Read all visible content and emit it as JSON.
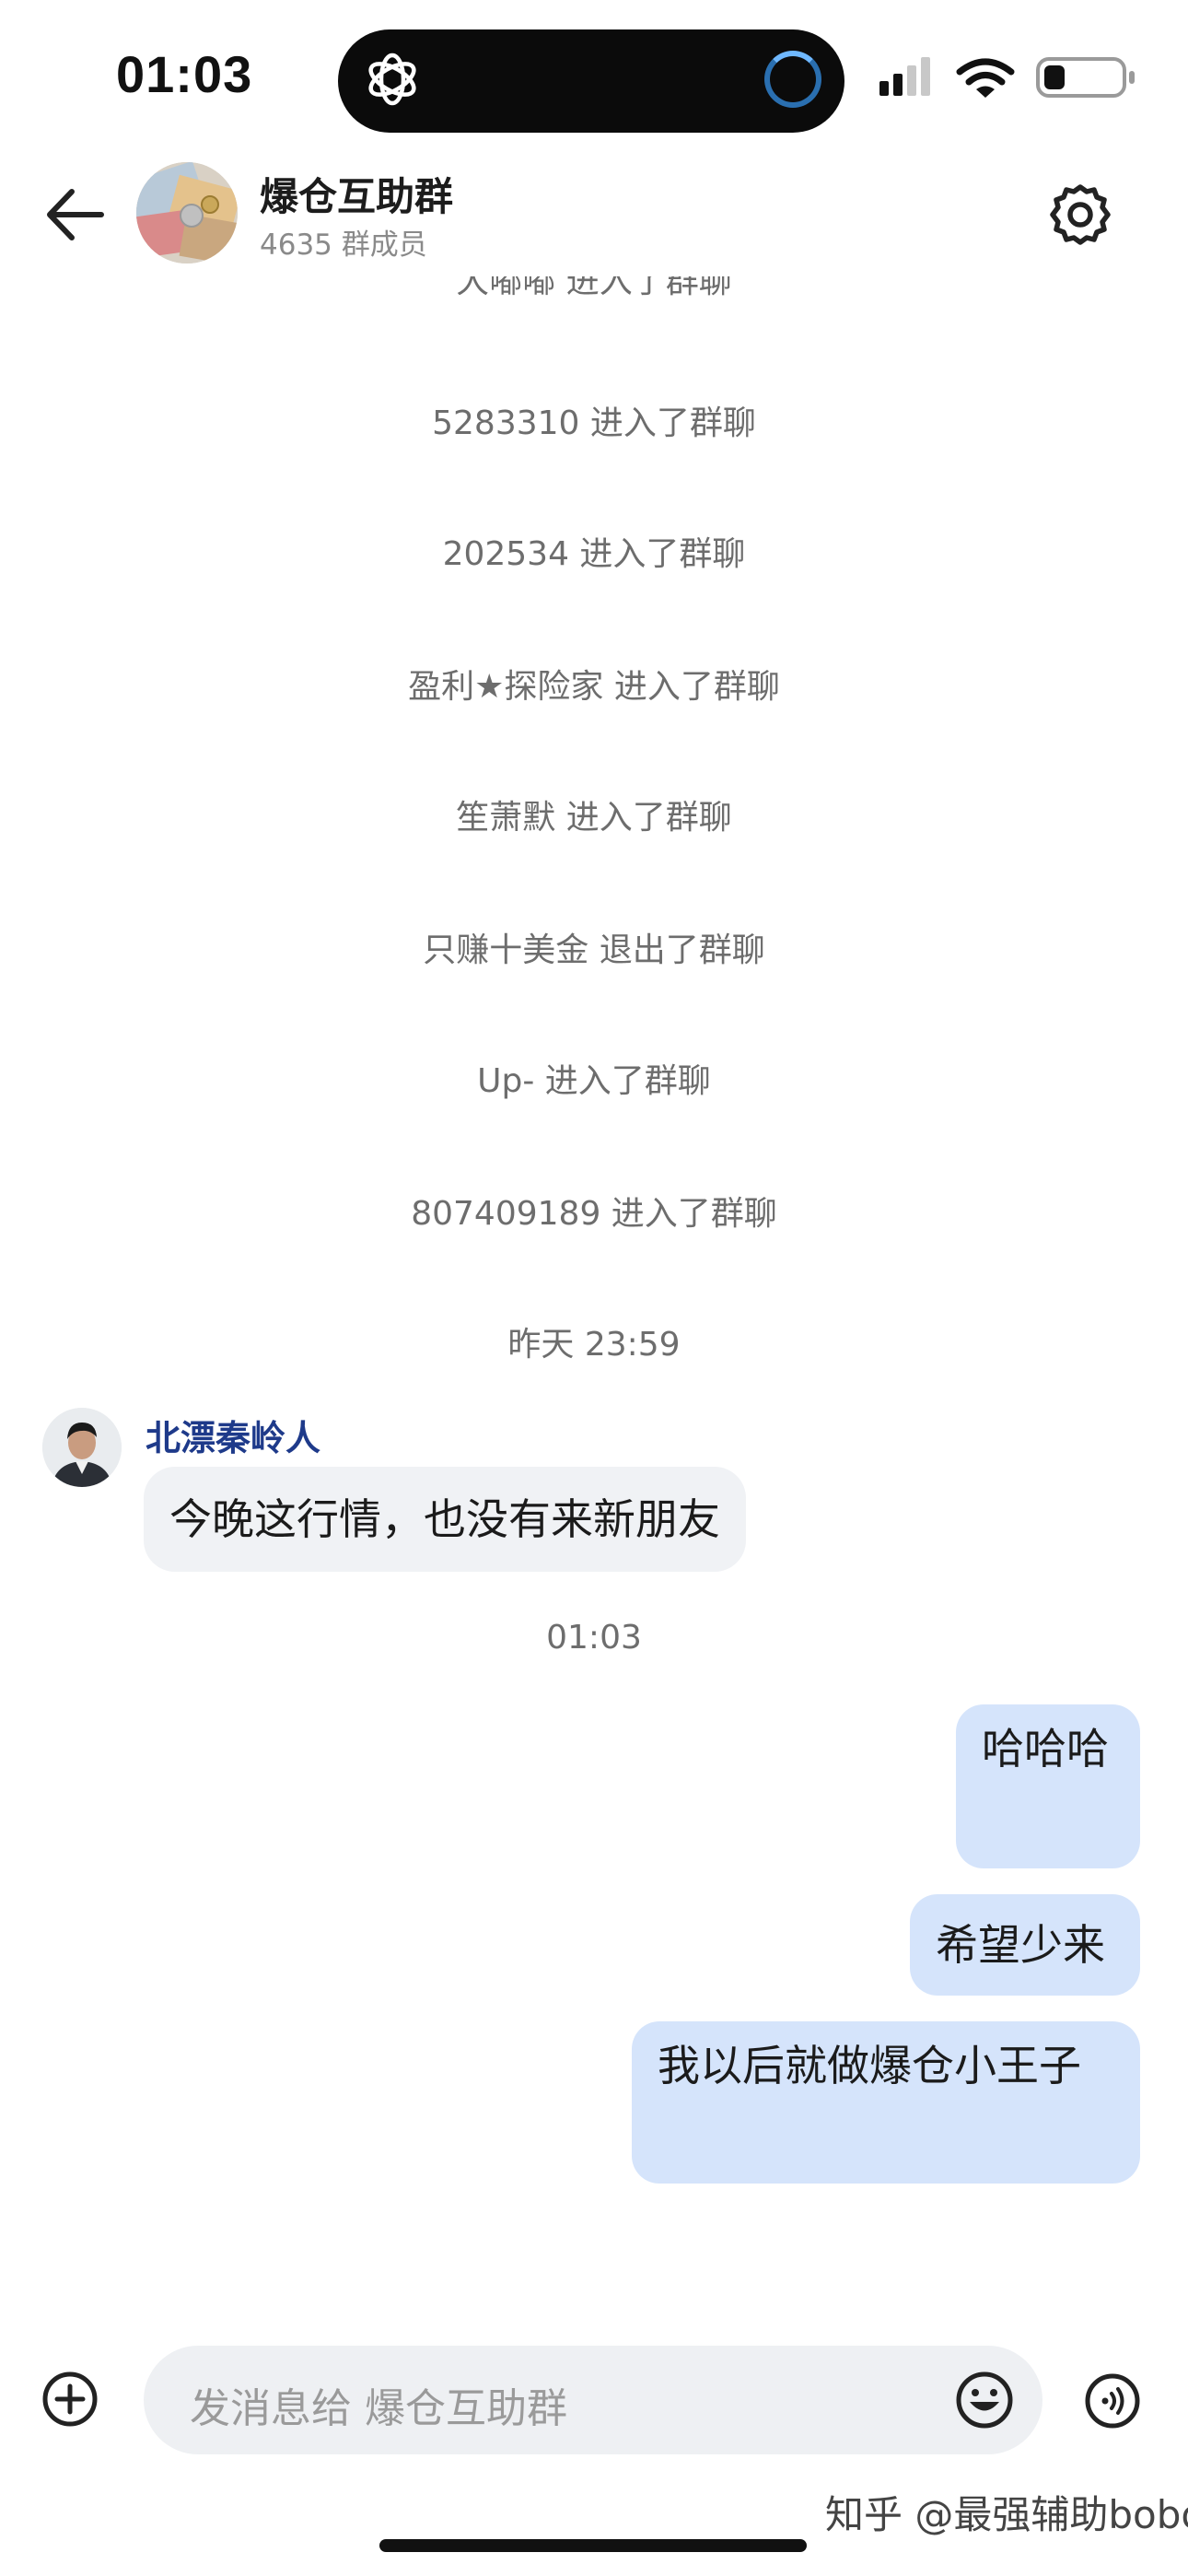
{
  "status_bar": {
    "time": "01:03"
  },
  "header": {
    "title": "爆仓互助群",
    "member_count": "4635 群成员"
  },
  "system_messages": [
    "大嘟嘟 进入了群聊",
    "5283310 进入了群聊",
    "202534 进入了群聊",
    "盈利★探险家 进入了群聊",
    "笙萧默 进入了群聊",
    "只赚十美金 退出了群聊",
    "Up- 进入了群聊",
    "807409189 进入了群聊"
  ],
  "timestamps": {
    "yesterday": "昨天 23:59",
    "now": "01:03"
  },
  "incoming": {
    "sender": "北漂秦岭人",
    "text": "今晚这行情，也没有来新朋友"
  },
  "outgoing": [
    {
      "text": "哈哈哈"
    },
    {
      "text": "希望少来"
    },
    {
      "text": "我以后就做爆仓小王子"
    }
  ],
  "composer": {
    "placeholder": "发消息给 爆仓互助群"
  },
  "watermark": "知乎 @最强辅助bobo",
  "colors": {
    "outgoing_bubble": "#d5e4fb",
    "incoming_bubble": "#f0f2f5",
    "sender_name": "#1e3a8a"
  },
  "icons": {
    "back": "back-arrow-icon",
    "settings": "gear-icon",
    "add": "plus-circle-icon",
    "emoji": "smiley-icon",
    "voice": "voice-icon",
    "app": "chatgpt-logo-icon"
  }
}
